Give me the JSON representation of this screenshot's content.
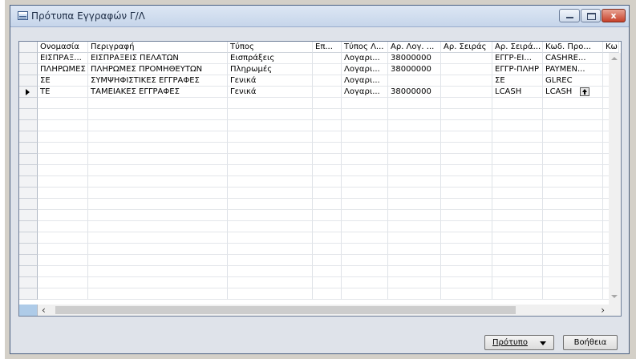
{
  "window": {
    "title": "Πρότυπα Εγγραφών Γ/Λ",
    "close_label": "x"
  },
  "grid": {
    "columns": [
      "Ονομασία",
      "Περιγραφή",
      "Τύπος",
      "Επ...",
      "Τύπος Λ...",
      "Αρ. Λογ. ...",
      "Αρ. Σειράς",
      "Αρ. Σειρά...",
      "Κωδ. Προ...",
      "Κω"
    ],
    "rows": [
      [
        "ΕΙΣΠΡΑΞ...",
        "ΕΙΣΠΡΑΞΕΙΣ ΠΕΛΑΤΩΝ",
        "Εισπράξεις",
        "",
        "Λογαρι...",
        "38000000",
        "",
        "ΕΓΓΡ-ΕΙ...",
        "CASHRE...",
        ""
      ],
      [
        "ΠΛΗΡΩΜΕΣ",
        "ΠΛΗΡΩΜΕΣ ΠΡΟΜΗΘΕΥΤΩΝ",
        "Πληρωμές",
        "",
        "Λογαρι...",
        "38000000",
        "",
        "ΕΓΓΡ-ΠΛΗΡ",
        "PAYMEN...",
        ""
      ],
      [
        "ΣΕ",
        "ΣΥΜΨΗΦΙΣΤΙΚΕΣ ΕΓΓΡΑΦΕΣ",
        "Γενικά",
        "",
        "Λογαρι...",
        "",
        "",
        "ΣΕ",
        "GLREC",
        ""
      ],
      [
        "ΤΕ",
        "ΤΑΜΕΙΑΚΕΣ ΕΓΓΡΑΦΕΣ",
        "Γενικά",
        "",
        "Λογαρι...",
        "38000000",
        "",
        "LCASH",
        "LCASH",
        ""
      ]
    ],
    "selected_row": 3
  },
  "buttons": {
    "template": "Πρότυπο",
    "help": "Βοήθεια"
  },
  "icons": {
    "app": "table-icon",
    "lookup": "lookup-arrow-icon"
  },
  "colors": {
    "title_text": "#1b2b44",
    "selection": "#aecbe8",
    "close_button": "#c7412a"
  }
}
